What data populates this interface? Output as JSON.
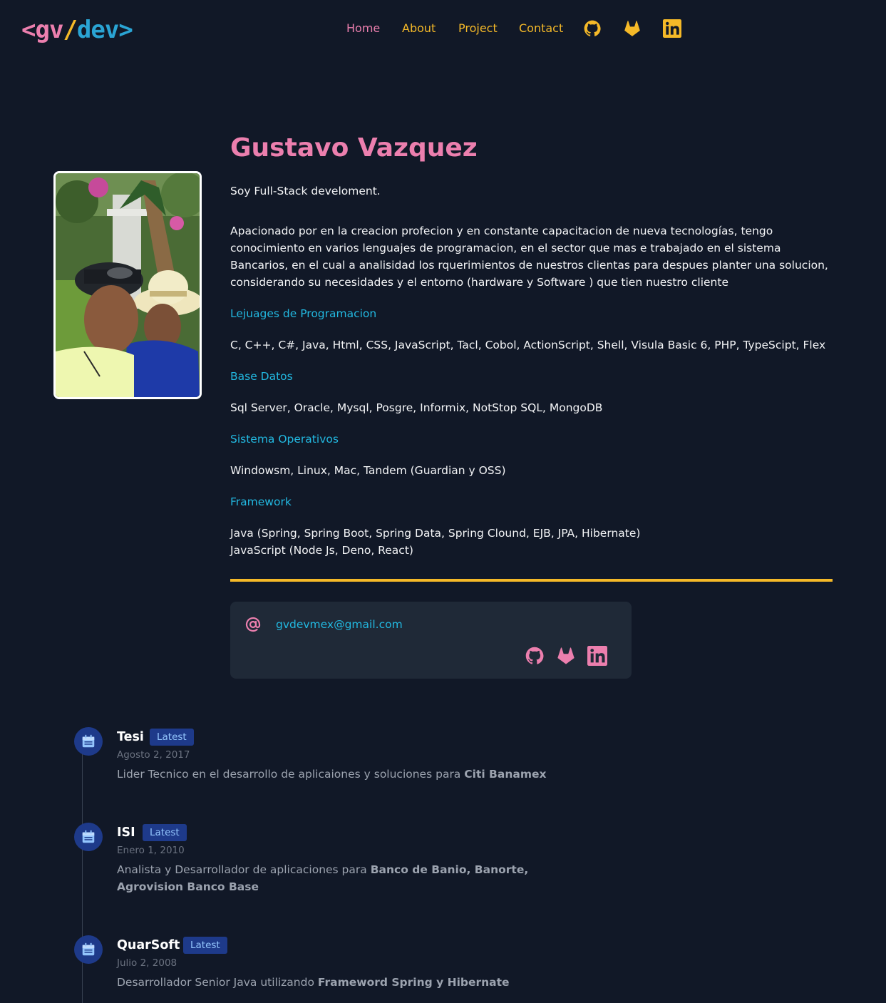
{
  "logo": {
    "open": "<",
    "gv": "gv",
    "slash": "/",
    "dev": "dev",
    "close": ">"
  },
  "nav": {
    "items": [
      {
        "label": "Home",
        "active": true
      },
      {
        "label": "About",
        "active": false
      },
      {
        "label": "Project",
        "active": false
      },
      {
        "label": "Contact",
        "active": false
      }
    ],
    "icons": [
      "github-icon",
      "gitlab-icon",
      "linkedin-icon"
    ]
  },
  "profile": {
    "name": "Gustavo Vazquez",
    "tagline": "Soy Full-Stack develoment.",
    "bio": "Apacionado por en la creacion profecion y en constante capacitacion de nueva tecnologías, tengo conocimiento en varios lenguajes de programacion, en el sector que mas e trabajado en el sistema Bancarios, en el cual a analisidad los rquerimientos de nuestros clientas para despues planter una solucion, considerando su necesidades y el entorno (hardware y Software ) que tien nuestro cliente",
    "sections": [
      {
        "heading": "Lejuages de Programacion",
        "lines": [
          "C, C++, C#, Java, Html, CSS, JavaScript, Tacl, Cobol, ActionScript, Shell, Visula Basic 6, PHP, TypeScipt, Flex"
        ]
      },
      {
        "heading": "Base Datos",
        "lines": [
          "Sql Server, Oracle, Mysql, Posgre, Informix, NotStop SQL, MongoDB"
        ]
      },
      {
        "heading": "Sistema Operativos",
        "lines": [
          "Windowsm, Linux, Mac, Tandem (Guardian y OSS)"
        ]
      },
      {
        "heading": "Framework",
        "lines": [
          "Java (Spring, Spring Boot, Spring Data, Spring Clound, EJB, JPA, Hibernate)",
          "JavaScript (Node Js, Deno, React)"
        ]
      }
    ]
  },
  "contact": {
    "email": "gvdevmex@gmail.com",
    "icons": [
      "at-icon",
      "github-icon",
      "gitlab-icon",
      "linkedin-icon"
    ]
  },
  "timeline": [
    {
      "title": "Tesi",
      "badge": "Latest",
      "date": "Agosto 2, 2017",
      "desc": "Lider Tecnico en el desarrollo de aplicaiones y soluciones para ",
      "desc_bold": "Citi Banamex"
    },
    {
      "title": "ISI",
      "badge": "Latest",
      "date": "Enero 1, 2010",
      "desc": "Analista y Desarrollador de aplicaciones para ",
      "desc_bold": "Banco de Banio, Banorte, Agrovision Banco Base"
    },
    {
      "title": "QuarSoft",
      "badge": "Latest",
      "date": "Julio 2, 2008",
      "desc": "Desarrollador Senior Java utilizando ",
      "desc_bold": "Frameword Spring y Hibernate"
    }
  ],
  "colors": {
    "background": "#111827",
    "pink": "#ec7fae",
    "yellow": "#f5b928",
    "cyan": "#22b8e0",
    "card": "#1f2937",
    "badge": "#1e3a8a"
  }
}
